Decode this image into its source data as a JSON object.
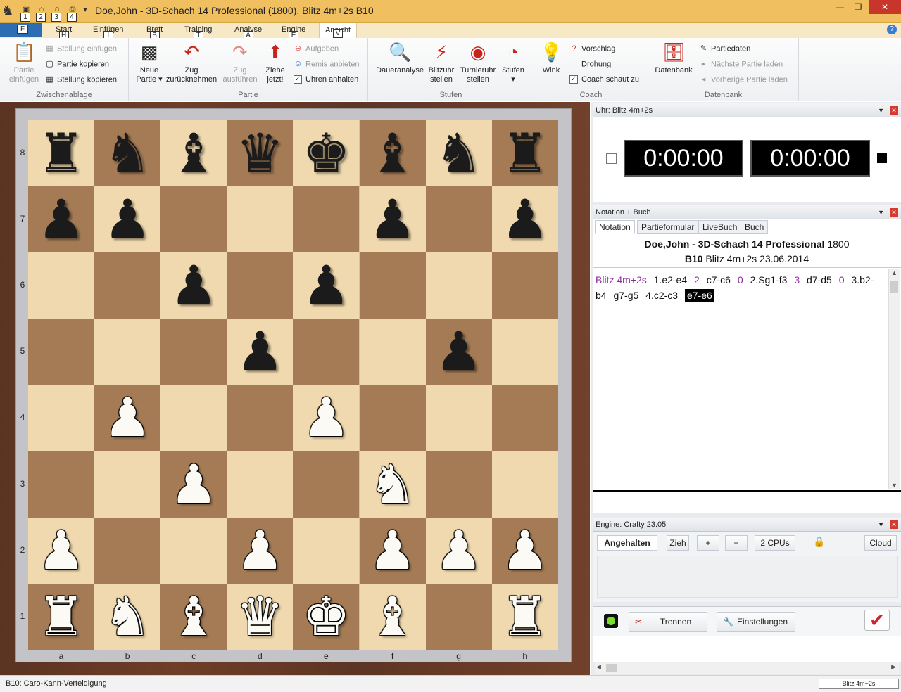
{
  "window": {
    "title": "Doe,John - 3D-Schach 14 Professional (1800), Blitz 4m+2s  B10",
    "minimize": "—",
    "restore": "❐",
    "close": "✕"
  },
  "quick_access": {
    "keytips": [
      "1",
      "2",
      "3",
      "4"
    ]
  },
  "tabs": {
    "file_label": "",
    "file_keytip": "F",
    "items": [
      {
        "label": "Start",
        "keytip": "H"
      },
      {
        "label": "Einfügen",
        "keytip": "I"
      },
      {
        "label": "Brett",
        "keytip": "B"
      },
      {
        "label": "Training",
        "keytip": "T"
      },
      {
        "label": "Analyse",
        "keytip": "A"
      },
      {
        "label": "Engine",
        "keytip": "E"
      },
      {
        "label": "Ansicht",
        "keytip": "V"
      }
    ],
    "help": "?"
  },
  "ribbon": {
    "zwischenablage": {
      "label": "Zwischenablage",
      "paste_game": "Partie\neinfügen",
      "paste_position": "Stellung einfügen",
      "copy_game": "Partie kopieren",
      "copy_position": "Stellung kopieren"
    },
    "partie": {
      "label": "Partie",
      "new_game": "Neue\nPartie ▾",
      "take_back": "Zug\nzurücknehmen",
      "replay": "Zug\nausführen",
      "move_now": "Ziehe\njetzt!",
      "resign": "Aufgeben",
      "offer_draw": "Remis anbieten",
      "stop_clocks": "Uhren anhalten"
    },
    "stufen": {
      "label": "Stufen",
      "infinite": "Daueranalyse",
      "blitz_clock": "Blitzuhr\nstellen",
      "tourn_clock": "Turnieruhr\nstellen",
      "levels": "Stufen\n▾"
    },
    "coach": {
      "label": "Coach",
      "hint": "Wink",
      "suggest": "Vorschlag",
      "threat": "Drohung",
      "coach_watches": "Coach schaut zu"
    },
    "datenbank": {
      "label": "Datenbank",
      "db": "Datenbank",
      "game_data": "Partiedaten",
      "next_game": "Nächste Partie laden",
      "prev_game": "Vorherige Partie laden"
    }
  },
  "board": {
    "ranks": [
      "8",
      "7",
      "6",
      "5",
      "4",
      "3",
      "2",
      "1"
    ],
    "files": [
      "a",
      "b",
      "c",
      "d",
      "e",
      "f",
      "g",
      "h"
    ],
    "position": [
      [
        "r",
        "n",
        "b",
        "q",
        "k",
        "b",
        "n",
        "r"
      ],
      [
        "p",
        "p",
        "",
        "",
        "",
        "p",
        "",
        "p"
      ],
      [
        "",
        "",
        "p",
        "",
        "p",
        "",
        "",
        ""
      ],
      [
        "",
        "",
        "",
        "p",
        "",
        "",
        "p",
        ""
      ],
      [
        "",
        "P",
        "",
        "",
        "P",
        "",
        "",
        ""
      ],
      [
        "",
        "",
        "P",
        "",
        "",
        "N",
        "",
        ""
      ],
      [
        "P",
        "",
        "",
        "P",
        "",
        "P",
        "P",
        "P"
      ],
      [
        "R",
        "N",
        "B",
        "Q",
        "K",
        "B",
        "",
        "R"
      ]
    ],
    "light_color": "#f0d9ae",
    "dark_color": "#a47b55"
  },
  "clock_panel": {
    "title": "Uhr: Blitz 4m+2s",
    "white_time": "0:00:00",
    "black_time": "0:00:00"
  },
  "notation_panel": {
    "title": "Notation + Buch",
    "tabs": [
      "Notation",
      "Partieformular",
      "LiveBuch",
      "Buch"
    ],
    "header_line1_bold": "Doe,John - 3D-Schach 14 Professional",
    "header_line1_rating": "1800",
    "header_line2_bold": "B10",
    "header_line2_rest": "Blitz 4m+2s 23.06.2014",
    "moves": [
      {
        "t": "Blitz 4m+2s",
        "k": "ann"
      },
      {
        "t": "1.e2-e4",
        "k": "mv"
      },
      {
        "t": "2",
        "k": "ann"
      },
      {
        "t": "c7-c6",
        "k": "mv"
      },
      {
        "t": "0",
        "k": "ann"
      },
      {
        "t": "2.Sg1-f3",
        "k": "mv"
      },
      {
        "t": "3",
        "k": "ann"
      },
      {
        "t": "d7-d5",
        "k": "mv"
      },
      {
        "t": "0",
        "k": "ann"
      },
      {
        "t": "3.b2-b4",
        "k": "mv"
      },
      {
        "t": "g7-g5",
        "k": "mv"
      },
      {
        "t": "4.c2-c3",
        "k": "mv"
      },
      {
        "t": "e7-e6",
        "k": "sel"
      }
    ]
  },
  "engine_panel": {
    "title": "Engine: Crafty 23.05",
    "status": "Angehalten",
    "move": "Zieh",
    "plus": "+",
    "minus": "−",
    "cpus": "2 CPUs",
    "cloud": "Cloud",
    "disconnect": "Trennen",
    "settings": "Einstellungen"
  },
  "statusbar": {
    "opening": "B10: Caro-Kann-Verteidigung",
    "time_control": "Blitz 4m+2s"
  }
}
